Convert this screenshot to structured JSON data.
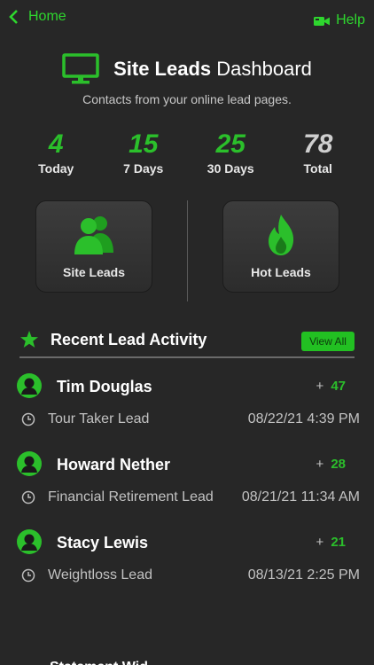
{
  "nav": {
    "back_label": "Home",
    "help_label": "Help"
  },
  "header": {
    "title_bold": "Site Leads",
    "title_rest": " Dashboard",
    "subtitle": "Contacts from your online lead pages."
  },
  "stats": [
    {
      "value": "4",
      "label": "Today"
    },
    {
      "value": "15",
      "label": "7 Days"
    },
    {
      "value": "25",
      "label": "30 Days"
    },
    {
      "value": "78",
      "label": "Total"
    }
  ],
  "tiles": {
    "site_leads": "Site Leads",
    "hot_leads": "Hot Leads"
  },
  "recent": {
    "title": "Recent Lead Activity",
    "view_all": "View All",
    "leads": [
      {
        "name": "Tim Douglas",
        "plus": "+",
        "count": "47",
        "type": "Tour Taker Lead",
        "time": "08/22/21 4:39 PM"
      },
      {
        "name": "Howard Nether",
        "plus": "+",
        "count": "28",
        "type": "Financial Retirement Lead",
        "time": "08/21/21 11:34 AM"
      },
      {
        "name": "Stacy Lewis",
        "plus": "+",
        "count": "21",
        "type": "Weightloss Lead",
        "time": "08/13/21 2:25 PM"
      }
    ]
  },
  "cutoff_text": "Statement Wid",
  "colors": {
    "accent": "#2bbf2b",
    "background": "#272727",
    "total": "#cfcfcf"
  },
  "icons": [
    "chevron-left-icon",
    "video-camera-icon",
    "monitor-icon",
    "users-icon",
    "flame-icon",
    "star-icon",
    "person-avatar-icon",
    "clock-icon"
  ]
}
